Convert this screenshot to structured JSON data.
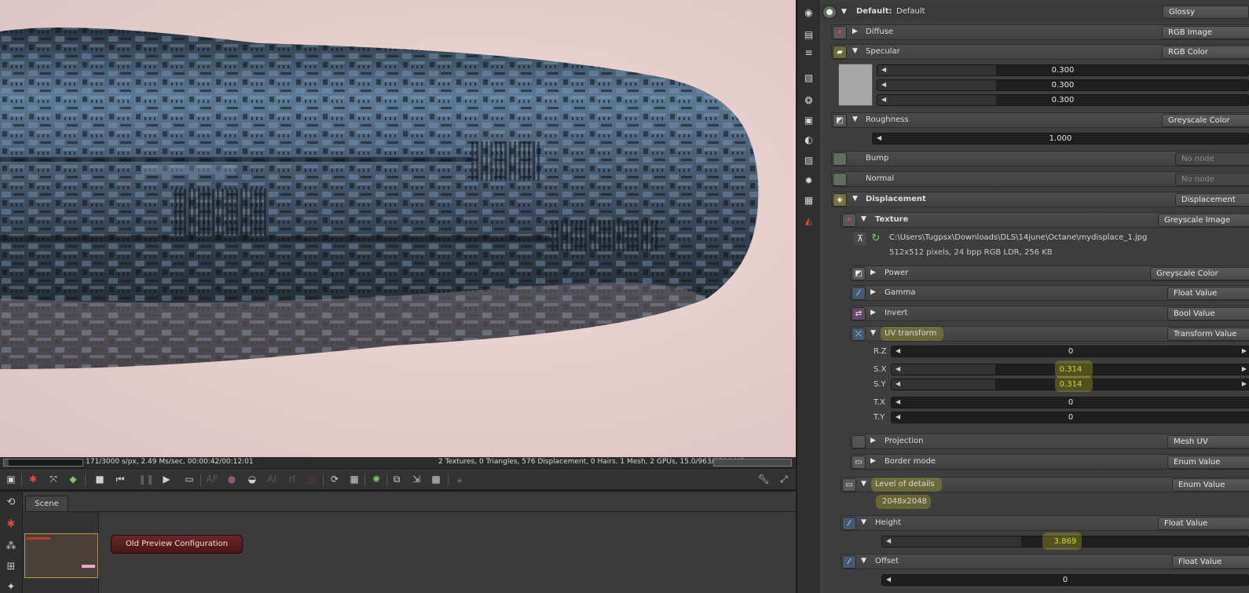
{
  "status": {
    "left": "171/3000 s/px, 2.49 Ms/sec, 00:00:42/00:12:01",
    "right": "2 Textures, 0 Triangles, 576 Displacement, 0 Hairs. 1 Mesh, 2 GPUs, 15.0/963/1536 MB",
    "progress": 0.057
  },
  "scene": {
    "tab": "Scene",
    "button": "Old Preview Configuration"
  },
  "material": {
    "header_label": "Default:",
    "header_name": "Default",
    "type": "Glossy",
    "diffuse": {
      "label": "Diffuse",
      "type": "RGB Image"
    },
    "specular": {
      "label": "Specular",
      "type": "RGB Color",
      "values": [
        "0.300",
        "0.300",
        "0.300"
      ]
    },
    "roughness": {
      "label": "Roughness",
      "type": "Greyscale Color",
      "value": "1.000"
    },
    "bump": {
      "label": "Bump",
      "type": "No node"
    },
    "normal": {
      "label": "Normal",
      "type": "No node"
    },
    "displacement": {
      "label": "Displacement",
      "type": "Displacement"
    },
    "texture": {
      "label": "Texture",
      "type": "Greyscale Image",
      "path": "C:\\Users\\Tugpsx\\Downloads\\DLS\\14june\\Octane\\mydisplace_1.jpg",
      "info": "512x512 pixels, 24 bpp RGB LDR, 256 KB"
    },
    "power": {
      "label": "Power",
      "type": "Greyscale Color"
    },
    "gamma": {
      "label": "Gamma",
      "type": "Float Value"
    },
    "invert": {
      "label": "Invert",
      "type": "Bool Value"
    },
    "uv_transform": {
      "label": "UV transform",
      "type": "Transform Value",
      "rz_label": "R.Z",
      "rz": "0",
      "sx_label": "S.X",
      "sx": "0.314",
      "sy_label": "S.Y",
      "sy": "0.314",
      "tx_label": "T.X",
      "tx": "0",
      "ty_label": "T.Y",
      "ty": "0"
    },
    "projection": {
      "label": "Projection",
      "type": "Mesh UV"
    },
    "border_mode": {
      "label": "Border mode",
      "type": "Enum Value"
    },
    "level_of_details": {
      "label": "Level of details",
      "type": "Enum Value",
      "value": "2048x2048"
    },
    "height": {
      "label": "Height",
      "type": "Float Value",
      "value": "3.869"
    },
    "offset": {
      "label": "Offset",
      "type": "Float Value",
      "value": "0"
    }
  }
}
